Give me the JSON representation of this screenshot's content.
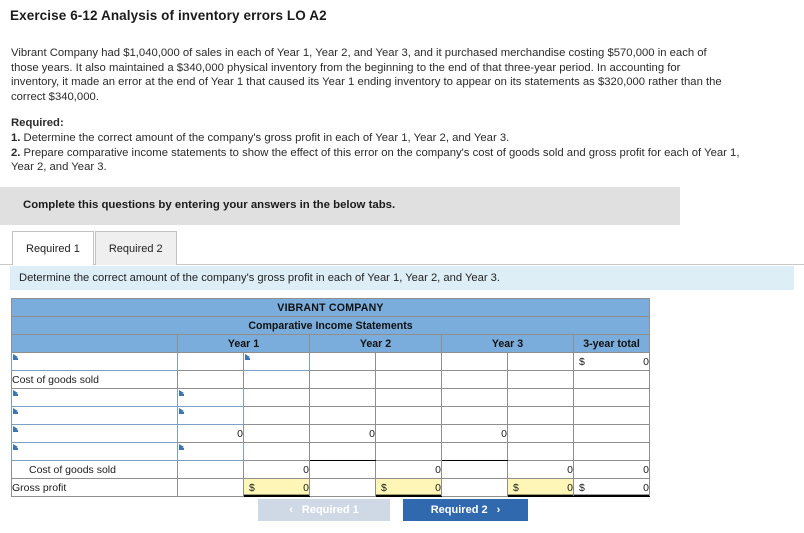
{
  "exercise": {
    "title": "Exercise 6-12 Analysis of inventory errors LO A2",
    "intro": "Vibrant Company had $1,040,000 of sales in each of Year 1, Year 2, and Year 3, and it purchased merchandise costing $570,000 in each of those years. It also maintained a $340,000 physical inventory from the beginning to the end of that three-year period. In accounting for inventory, it made an error at the end of Year 1 that caused its Year 1 ending inventory to appear on its statements as $320,000 rather than the correct $340,000."
  },
  "required": {
    "heading": "Required:",
    "items": [
      {
        "num": "1.",
        "text": " Determine the correct amount of the company's gross profit in each of Year 1, Year 2, and Year 3."
      },
      {
        "num": "2.",
        "text": " Prepare comparative income statements to show the effect of this error on the company's cost of goods sold and gross profit for each of Year 1, Year 2, and Year 3."
      }
    ]
  },
  "instruction_bar": {
    "text": "Complete this questions by entering your answers in the below tabs."
  },
  "tabs": [
    {
      "label": "Required 1",
      "active": true
    },
    {
      "label": "Required 2",
      "active": false
    }
  ],
  "tab_instruction": {
    "text": "Determine the correct amount of the company's gross profit in each of Year 1, Year 2, and Year 3."
  },
  "sheet": {
    "company": "VIBRANT COMPANY",
    "statement": "Comparative Income Statements",
    "columns": {
      "blank": "",
      "year1": "Year 1",
      "year2": "Year 2",
      "year3": "Year 3",
      "total": "3-year total"
    },
    "labels": {
      "row1": "",
      "cogs_header": "Cost of goods sold",
      "row3": "",
      "row4": "",
      "row5": "",
      "row6": "",
      "cogs_total": "Cost of goods sold",
      "gross_profit": "Gross profit"
    },
    "values": {
      "zero": "0",
      "dollar": "$",
      "empty": ""
    }
  },
  "nav": {
    "prev_label": "Required 1",
    "prev_chevron": "‹",
    "next_label": "Required 2",
    "next_chevron": "›"
  },
  "colors": {
    "header_blue": "#7aaddc",
    "strip_blue": "#ddeef7",
    "grey_bar": "#e0e0e0",
    "highlight_yellow": "#fdf6b6",
    "primary_button": "#3069ad",
    "disabled_button": "#cfd9e6",
    "input_border": "#7d9fc4"
  }
}
